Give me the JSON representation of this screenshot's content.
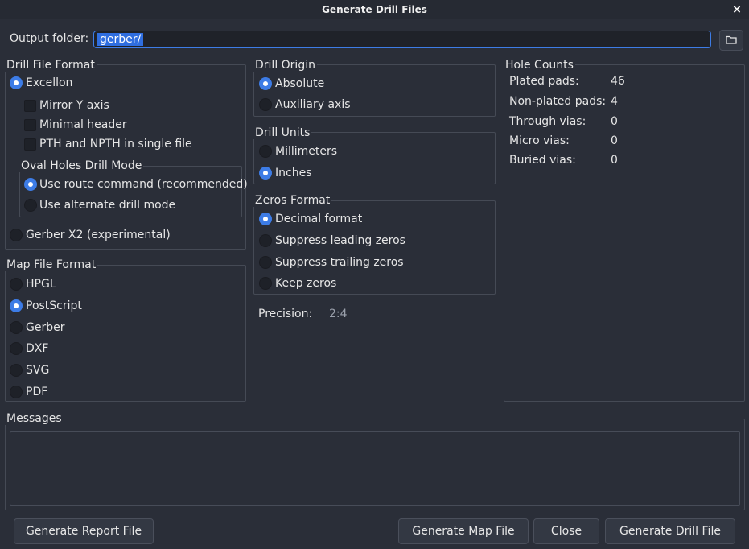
{
  "window": {
    "title": "Generate Drill Files",
    "close_glyph": "×"
  },
  "output": {
    "label": "Output folder:",
    "value": "gerber/"
  },
  "drill_format": {
    "title": "Drill File Format",
    "excellon": "Excellon",
    "mirror_y": "Mirror Y axis",
    "minimal_header": "Minimal header",
    "pth_npth_single": "PTH and NPTH in single file",
    "oval": {
      "title": "Oval Holes Drill Mode",
      "route": "Use route command (recommended)",
      "alternate": "Use alternate drill mode"
    },
    "gerber_x2": "Gerber X2 (experimental)"
  },
  "map_format": {
    "title": "Map File Format",
    "options": [
      "HPGL",
      "PostScript",
      "Gerber",
      "DXF",
      "SVG",
      "PDF"
    ],
    "selected": "PostScript"
  },
  "drill_origin": {
    "title": "Drill Origin",
    "absolute": "Absolute",
    "auxiliary": "Auxiliary axis"
  },
  "drill_units": {
    "title": "Drill Units",
    "millimeters": "Millimeters",
    "inches": "Inches"
  },
  "zeros_format": {
    "title": "Zeros Format",
    "decimal": "Decimal format",
    "suppress_leading": "Suppress leading zeros",
    "suppress_trailing": "Suppress trailing zeros",
    "keep": "Keep zeros"
  },
  "precision": {
    "label": "Precision:",
    "value": "2:4"
  },
  "hole_counts": {
    "title": "Hole Counts",
    "rows": [
      {
        "label": "Plated pads:",
        "value": "46"
      },
      {
        "label": "Non-plated pads:",
        "value": "4"
      },
      {
        "label": "Through vias:",
        "value": "0"
      },
      {
        "label": "Micro vias:",
        "value": "0"
      },
      {
        "label": "Buried vias:",
        "value": "0"
      }
    ]
  },
  "messages": {
    "title": "Messages"
  },
  "buttons": {
    "report": "Generate Report File",
    "map": "Generate Map File",
    "close": "Close",
    "drill": "Generate Drill File"
  },
  "colors": {
    "accent": "#3d7ce6",
    "background": "#2a2e38"
  },
  "icons": {
    "folder": "folder-icon",
    "close": "close-icon"
  }
}
